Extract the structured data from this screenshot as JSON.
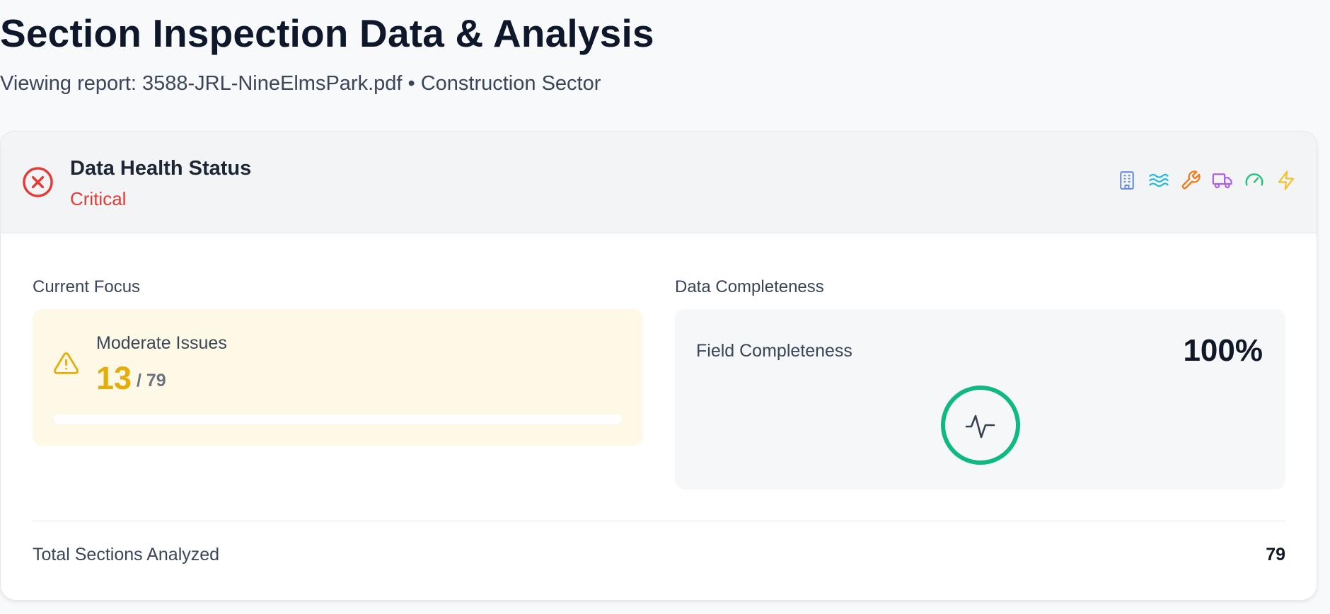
{
  "page": {
    "title": "Section Inspection Data & Analysis",
    "subtitle": "Viewing report: 3588-JRL-NineElmsPark.pdf • Construction Sector"
  },
  "health": {
    "title": "Data Health Status",
    "status": "Critical",
    "status_color": "#e53935",
    "status_icon": "x-circle-icon",
    "category_icons": [
      {
        "name": "building-icon",
        "color": "#6b8de3"
      },
      {
        "name": "waves-icon",
        "color": "#22b8d6"
      },
      {
        "name": "wrench-icon",
        "color": "#f07b1a"
      },
      {
        "name": "truck-icon",
        "color": "#b15ee6"
      },
      {
        "name": "gauge-icon",
        "color": "#22c07a"
      },
      {
        "name": "zap-icon",
        "color": "#f0c22e"
      }
    ]
  },
  "focus": {
    "section_label": "Current Focus",
    "label": "Moderate Issues",
    "count": "13",
    "total": "/ 79",
    "accent": "#e5ad09",
    "progress": 0
  },
  "completeness": {
    "section_label": "Data Completeness",
    "label": "Field Completeness",
    "value": "100%",
    "ring_color": "#10b981",
    "icon": "activity-icon"
  },
  "summary": {
    "label": "Total Sections Analyzed",
    "value": "79"
  }
}
